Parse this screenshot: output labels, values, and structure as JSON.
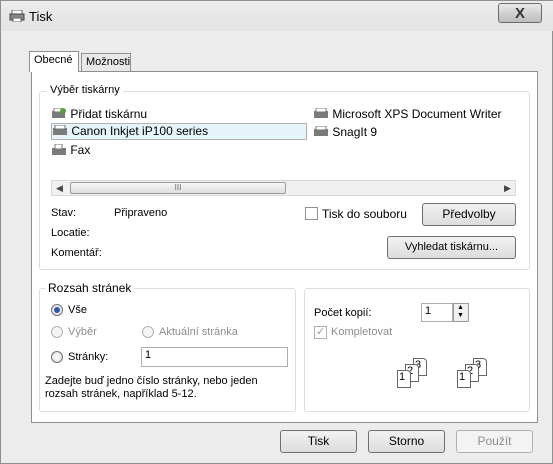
{
  "window": {
    "title": "Tisk",
    "close_symbol": "X"
  },
  "tabs": [
    {
      "label": "Obecné",
      "active": true
    },
    {
      "label": "Možnosti",
      "active": false
    }
  ],
  "printer_select": {
    "legend": "Výběr tiskárny",
    "printers_left": [
      "Přidat tiskárnu",
      "Canon Inkjet iP100 series",
      "Fax"
    ],
    "printers_right": [
      "Microsoft XPS Document Writer",
      "SnagIt 9"
    ],
    "selected": "Canon Inkjet iP100 series",
    "scroll_grip": "III",
    "status_label": "Stav:",
    "status_value": "Připraveno",
    "location_label": "Locatie:",
    "location_value": "",
    "comment_label": "Komentář:",
    "comment_value": "",
    "print_to_file_label": "Tisk do souboru",
    "preferences_button": "Předvolby",
    "find_printer_button": "Vyhledat tiskárnu..."
  },
  "page_range": {
    "legend": "Rozsah stránek",
    "all_label": "Vše",
    "selection_label": "Výběr",
    "current_page_label": "Aktuální stránka",
    "pages_label": "Stránky:",
    "pages_value": "1",
    "hint": "Zadejte buď jedno číslo stránky, nebo jeden rozsah stránek, například 5-12."
  },
  "copies": {
    "count_label": "Počet kopií:",
    "count_value": "1",
    "collate_label": "Kompletovat",
    "collate_digits": [
      "1",
      "2",
      "3"
    ]
  },
  "footer": {
    "print_button": "Tisk",
    "cancel_button": "Storno",
    "apply_button": "Použít"
  },
  "colors": {
    "window_bg": "#ececec",
    "panel_bg": "#ffffff",
    "selection_bg": "#e5f3fb",
    "radio_accent": "#2e5aa8"
  }
}
